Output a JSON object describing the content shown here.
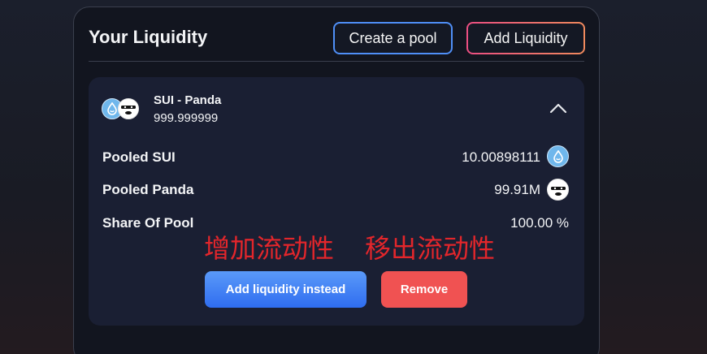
{
  "panel": {
    "title": "Your Liquidity",
    "create_pool_label": "Create a pool",
    "add_liquidity_label": "Add Liquidity"
  },
  "position": {
    "pair_name": "SUI - Panda",
    "lp_amount": "999.999999",
    "expanded": true,
    "rows": [
      {
        "label": "Pooled SUI",
        "value": "10.00898111",
        "icon": "sui-token-icon"
      },
      {
        "label": "Pooled Panda",
        "value": "99.91M",
        "icon": "panda-token-icon"
      },
      {
        "label": "Share Of Pool",
        "value": "100.00 %"
      }
    ],
    "add_instead_label": "Add liquidity instead",
    "remove_label": "Remove"
  },
  "annotations": {
    "add_note": "增加流动性",
    "remove_note": "移出流动性"
  },
  "colors": {
    "create_border": "#4f8ff7",
    "add_border_from": "#ec4e82",
    "add_border_to": "#f08a5d",
    "primary": "#3b82f6",
    "remove": "#f05252",
    "annotation": "#e3262b"
  }
}
